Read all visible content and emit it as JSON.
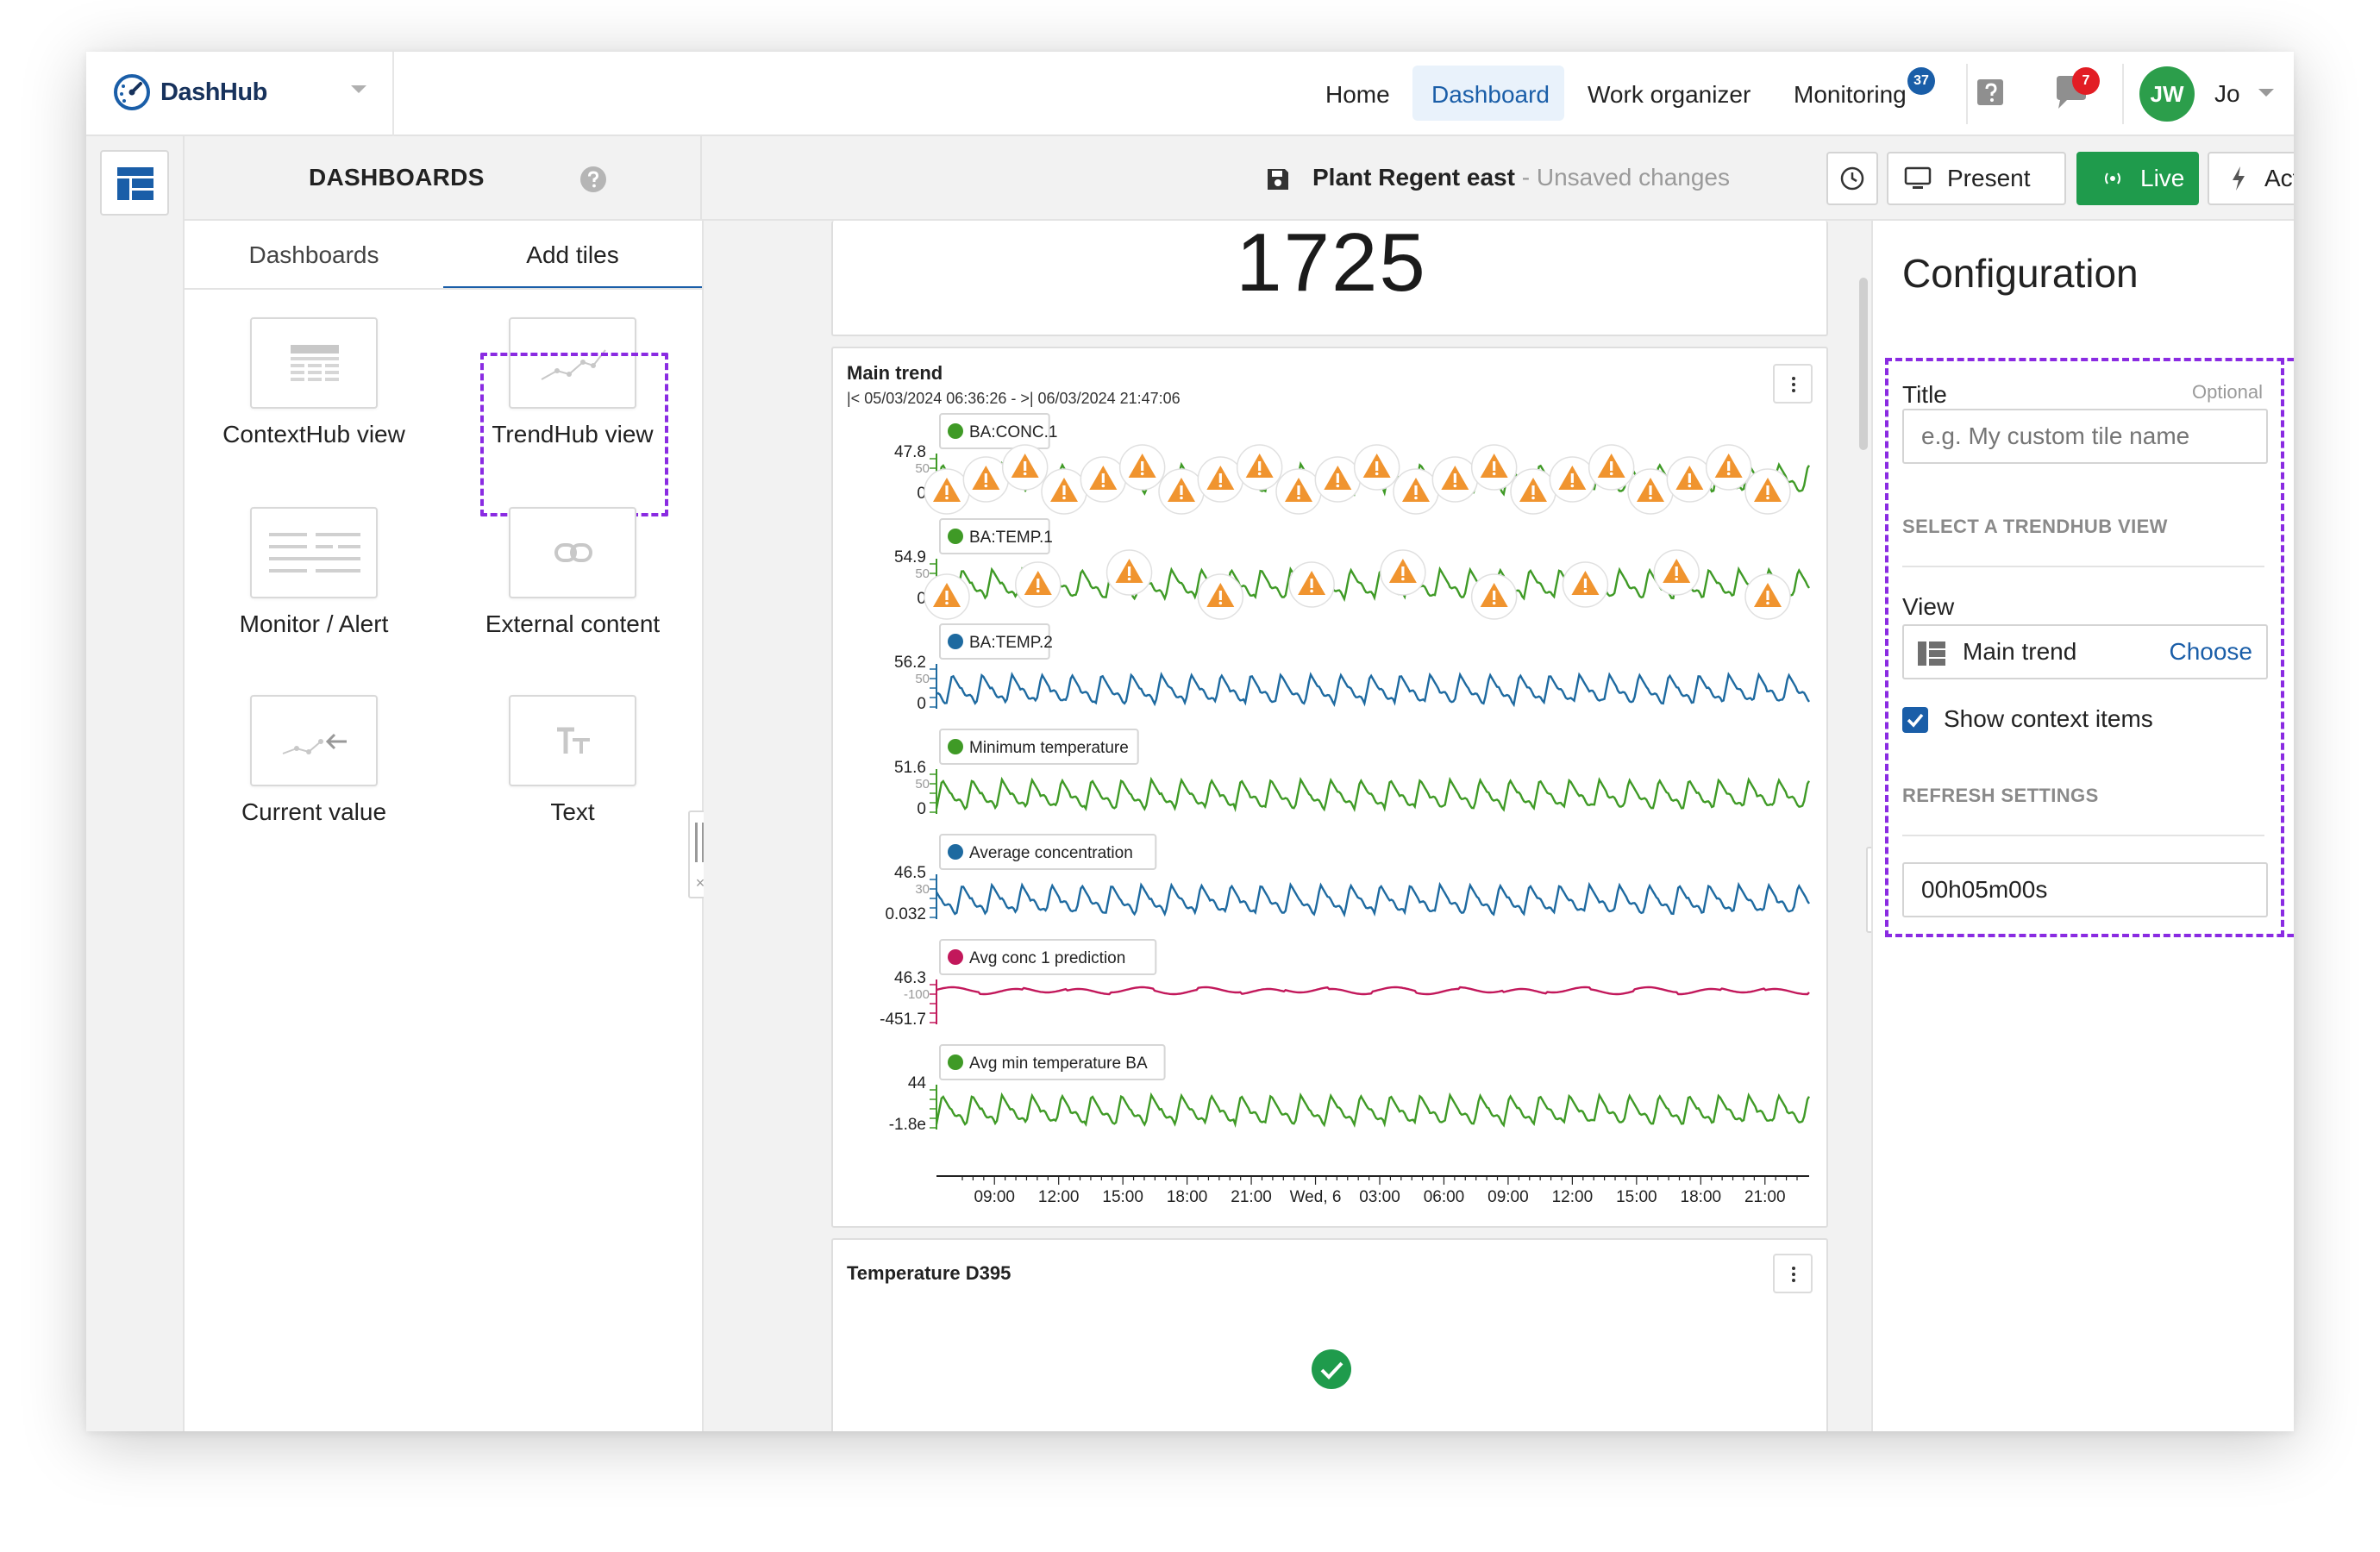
{
  "app": {
    "name": "DashHub"
  },
  "nav": {
    "home": "Home",
    "dashboard": "Dashboard",
    "work_organizer": "Work organizer",
    "monitoring": "Monitoring",
    "monitoring_badge": "37",
    "notifications_badge": "7",
    "avatar_initials": "JW",
    "user_name": "Jo"
  },
  "subheader": {
    "section_title": "DASHBOARDS",
    "page_name": "Plant Regent east",
    "separator": " - ",
    "unsaved": "Unsaved changes",
    "present_label": "Present",
    "live_label": "Live",
    "actions_label": "Actions"
  },
  "left_panel": {
    "tabs": [
      "Dashboards",
      "Add tiles"
    ],
    "tiles": [
      {
        "label": "ContextHub view",
        "icon": "table-icon"
      },
      {
        "label": "TrendHub view",
        "icon": "trend-line-icon"
      },
      {
        "label": "Monitor / Alert",
        "icon": "list-icon"
      },
      {
        "label": "External content",
        "icon": "link-icon"
      },
      {
        "label": "Current value",
        "icon": "arrow-left-trend-icon"
      },
      {
        "label": "Text",
        "icon": "text-icon"
      }
    ]
  },
  "center": {
    "big_number": "1725",
    "trend_card": {
      "title": "Main trend",
      "range": "|< 05/03/2024 06:36:26 - >| 06/03/2024 21:47:06"
    },
    "temp_card": {
      "title": "Temperature D395"
    }
  },
  "chart_data": {
    "type": "line",
    "title": "Main trend",
    "series": [
      {
        "name": "BA:CONC.1",
        "color": "#3f9a26",
        "top_label": "47.8",
        "mid_label": "50",
        "bottom_label": "0",
        "alerts": 22
      },
      {
        "name": "BA:TEMP.1",
        "color": "#3f9a26",
        "top_label": "54.9",
        "mid_label": "50",
        "bottom_label": "0",
        "alerts": 10
      },
      {
        "name": "BA:TEMP.2",
        "color": "#1e6aa0",
        "top_label": "56.2",
        "mid_label": "50",
        "bottom_label": "0",
        "alerts": 0
      },
      {
        "name": "Minimum temperature",
        "color": "#3f9a26",
        "top_label": "51.6",
        "mid_label": "50",
        "bottom_label": "0",
        "alerts": 0
      },
      {
        "name": "Average concentration",
        "color": "#1e6aa0",
        "top_label": "46.5",
        "mid_label": "30",
        "bottom_label": "0.032",
        "alerts": 0
      },
      {
        "name": "Avg conc 1 prediction",
        "color": "#c2185b",
        "top_label": "46.3",
        "mid_label": "-100",
        "bottom_label": "-451.7",
        "alerts": 0
      },
      {
        "name": "Avg min temperature BA",
        "color": "#3f9a26",
        "top_label": "44",
        "mid_label": "",
        "bottom_label": "-1.8e",
        "alerts": 0
      }
    ],
    "x_ticks": [
      "09:00",
      "12:00",
      "15:00",
      "18:00",
      "21:00",
      "Wed, 6",
      "03:00",
      "06:00",
      "09:00",
      "12:00",
      "15:00",
      "18:00",
      "21:00"
    ]
  },
  "config": {
    "title": "Configuration",
    "title_label": "Title",
    "optional": "Optional",
    "title_placeholder": "e.g. My custom tile name",
    "section_view": "SELECT A TRENDHUB VIEW",
    "view_label": "View",
    "view_value": "Main trend",
    "choose_label": "Choose",
    "show_context_label": "Show context items",
    "show_context_checked": true,
    "section_refresh": "REFRESH SETTINGS",
    "refresh_value": "00h05m00s"
  },
  "colors": {
    "accent": "#1a5ea8",
    "live": "#1f9b4c",
    "selection": "#8a2be2",
    "alert": "#f0942f",
    "success": "#1f9b4c"
  }
}
